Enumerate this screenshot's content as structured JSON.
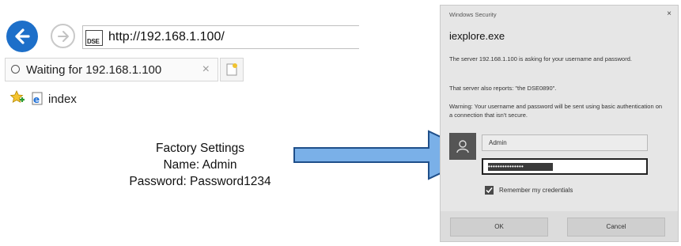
{
  "browser": {
    "address_url": "http://192.168.1.100/",
    "favicon_text": "DSE",
    "tab": {
      "title": "Waiting for 192.168.1.100",
      "close": "×"
    },
    "favorites": [
      {
        "icon": "favorites-star-icon"
      },
      {
        "icon": "ie-page-icon",
        "label": "index"
      }
    ]
  },
  "annotation": {
    "line1": "Factory Settings",
    "line2": "Name: Admin",
    "line3": "Password: Password1234"
  },
  "dialog": {
    "title": "Windows Security",
    "close": "×",
    "app": "iexplore.exe",
    "message1": "The server 192.168.1.100 is asking for your username and password.",
    "message2": "That server also reports: \"the DSE0890\".",
    "warning": "Warning: Your username and password will be sent using basic authentication on a connection that isn't secure.",
    "username": "Admin",
    "password_mask": "•••••••••••••••",
    "remember_label": "Remember my credentials",
    "remember_checked": true,
    "ok_label": "OK",
    "cancel_label": "Cancel"
  },
  "colors": {
    "back_button": "#1d6fc9",
    "arrow_fill": "#7ab0e8",
    "arrow_stroke": "#1f4f8a"
  }
}
